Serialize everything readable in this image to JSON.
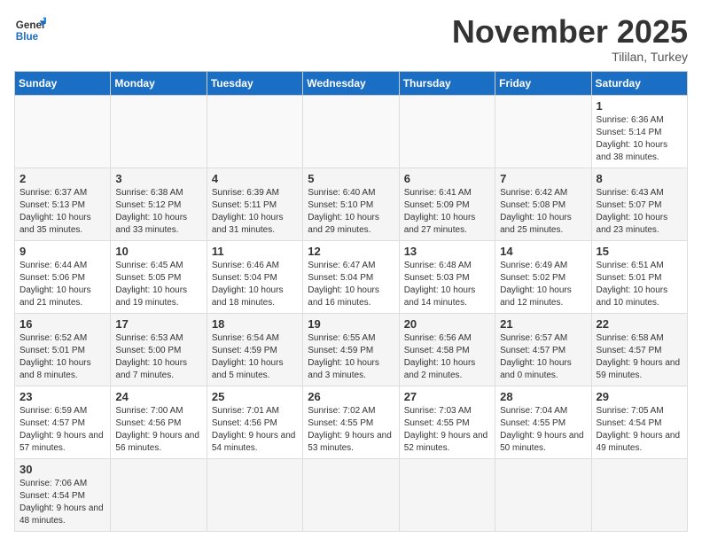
{
  "logo": {
    "general": "General",
    "blue": "Blue"
  },
  "title": "November 2025",
  "location": "Tililan, Turkey",
  "weekdays": [
    "Sunday",
    "Monday",
    "Tuesday",
    "Wednesday",
    "Thursday",
    "Friday",
    "Saturday"
  ],
  "weeks": [
    [
      {
        "day": "",
        "info": ""
      },
      {
        "day": "",
        "info": ""
      },
      {
        "day": "",
        "info": ""
      },
      {
        "day": "",
        "info": ""
      },
      {
        "day": "",
        "info": ""
      },
      {
        "day": "",
        "info": ""
      },
      {
        "day": "1",
        "info": "Sunrise: 6:36 AM\nSunset: 5:14 PM\nDaylight: 10 hours and 38 minutes."
      }
    ],
    [
      {
        "day": "2",
        "info": "Sunrise: 6:37 AM\nSunset: 5:13 PM\nDaylight: 10 hours and 35 minutes."
      },
      {
        "day": "3",
        "info": "Sunrise: 6:38 AM\nSunset: 5:12 PM\nDaylight: 10 hours and 33 minutes."
      },
      {
        "day": "4",
        "info": "Sunrise: 6:39 AM\nSunset: 5:11 PM\nDaylight: 10 hours and 31 minutes."
      },
      {
        "day": "5",
        "info": "Sunrise: 6:40 AM\nSunset: 5:10 PM\nDaylight: 10 hours and 29 minutes."
      },
      {
        "day": "6",
        "info": "Sunrise: 6:41 AM\nSunset: 5:09 PM\nDaylight: 10 hours and 27 minutes."
      },
      {
        "day": "7",
        "info": "Sunrise: 6:42 AM\nSunset: 5:08 PM\nDaylight: 10 hours and 25 minutes."
      },
      {
        "day": "8",
        "info": "Sunrise: 6:43 AM\nSunset: 5:07 PM\nDaylight: 10 hours and 23 minutes."
      }
    ],
    [
      {
        "day": "9",
        "info": "Sunrise: 6:44 AM\nSunset: 5:06 PM\nDaylight: 10 hours and 21 minutes."
      },
      {
        "day": "10",
        "info": "Sunrise: 6:45 AM\nSunset: 5:05 PM\nDaylight: 10 hours and 19 minutes."
      },
      {
        "day": "11",
        "info": "Sunrise: 6:46 AM\nSunset: 5:04 PM\nDaylight: 10 hours and 18 minutes."
      },
      {
        "day": "12",
        "info": "Sunrise: 6:47 AM\nSunset: 5:04 PM\nDaylight: 10 hours and 16 minutes."
      },
      {
        "day": "13",
        "info": "Sunrise: 6:48 AM\nSunset: 5:03 PM\nDaylight: 10 hours and 14 minutes."
      },
      {
        "day": "14",
        "info": "Sunrise: 6:49 AM\nSunset: 5:02 PM\nDaylight: 10 hours and 12 minutes."
      },
      {
        "day": "15",
        "info": "Sunrise: 6:51 AM\nSunset: 5:01 PM\nDaylight: 10 hours and 10 minutes."
      }
    ],
    [
      {
        "day": "16",
        "info": "Sunrise: 6:52 AM\nSunset: 5:01 PM\nDaylight: 10 hours and 8 minutes."
      },
      {
        "day": "17",
        "info": "Sunrise: 6:53 AM\nSunset: 5:00 PM\nDaylight: 10 hours and 7 minutes."
      },
      {
        "day": "18",
        "info": "Sunrise: 6:54 AM\nSunset: 4:59 PM\nDaylight: 10 hours and 5 minutes."
      },
      {
        "day": "19",
        "info": "Sunrise: 6:55 AM\nSunset: 4:59 PM\nDaylight: 10 hours and 3 minutes."
      },
      {
        "day": "20",
        "info": "Sunrise: 6:56 AM\nSunset: 4:58 PM\nDaylight: 10 hours and 2 minutes."
      },
      {
        "day": "21",
        "info": "Sunrise: 6:57 AM\nSunset: 4:57 PM\nDaylight: 10 hours and 0 minutes."
      },
      {
        "day": "22",
        "info": "Sunrise: 6:58 AM\nSunset: 4:57 PM\nDaylight: 9 hours and 59 minutes."
      }
    ],
    [
      {
        "day": "23",
        "info": "Sunrise: 6:59 AM\nSunset: 4:57 PM\nDaylight: 9 hours and 57 minutes."
      },
      {
        "day": "24",
        "info": "Sunrise: 7:00 AM\nSunset: 4:56 PM\nDaylight: 9 hours and 56 minutes."
      },
      {
        "day": "25",
        "info": "Sunrise: 7:01 AM\nSunset: 4:56 PM\nDaylight: 9 hours and 54 minutes."
      },
      {
        "day": "26",
        "info": "Sunrise: 7:02 AM\nSunset: 4:55 PM\nDaylight: 9 hours and 53 minutes."
      },
      {
        "day": "27",
        "info": "Sunrise: 7:03 AM\nSunset: 4:55 PM\nDaylight: 9 hours and 52 minutes."
      },
      {
        "day": "28",
        "info": "Sunrise: 7:04 AM\nSunset: 4:55 PM\nDaylight: 9 hours and 50 minutes."
      },
      {
        "day": "29",
        "info": "Sunrise: 7:05 AM\nSunset: 4:54 PM\nDaylight: 9 hours and 49 minutes."
      }
    ],
    [
      {
        "day": "30",
        "info": "Sunrise: 7:06 AM\nSunset: 4:54 PM\nDaylight: 9 hours and 48 minutes."
      },
      {
        "day": "",
        "info": ""
      },
      {
        "day": "",
        "info": ""
      },
      {
        "day": "",
        "info": ""
      },
      {
        "day": "",
        "info": ""
      },
      {
        "day": "",
        "info": ""
      },
      {
        "day": "",
        "info": ""
      }
    ]
  ]
}
